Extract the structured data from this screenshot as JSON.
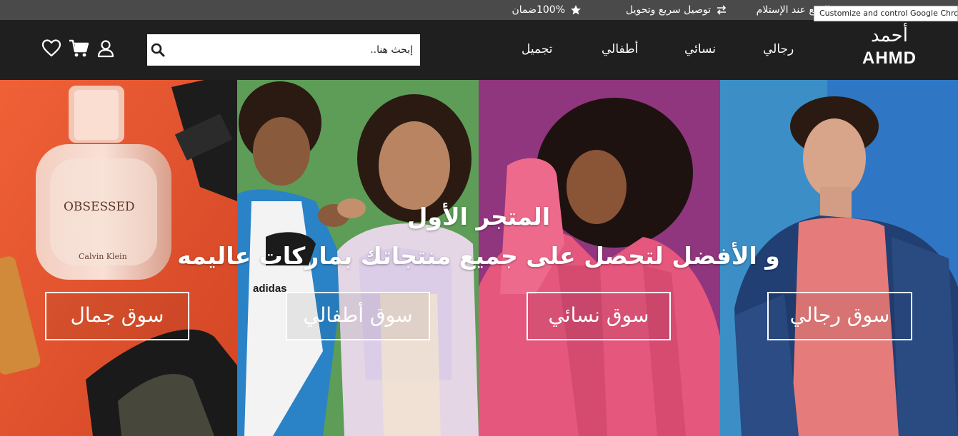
{
  "topbar": {
    "perks": [
      {
        "icon": "box-icon",
        "label": "الدفع عند الإستلام"
      },
      {
        "icon": "exchange-arrows-icon",
        "label": "توصيل سريع وتحويل"
      },
      {
        "icon": "star-icon",
        "label": "100%ضمان"
      }
    ],
    "tooltip": "Customize and control Google Chrome"
  },
  "header": {
    "logo_ar": "أحمد",
    "logo_en": "AHMD",
    "nav": [
      "رجالي",
      "نسائي",
      "أطفالي",
      "تجميل"
    ],
    "search_placeholder": "إبحث هنا..",
    "icons": [
      "user-icon",
      "cart-icon",
      "heart-icon"
    ]
  },
  "hero": {
    "headline_1": "المتجر الأول",
    "headline_2": "و الأفضل لتحصل على جميع منتجاتك بماركات عاليمه",
    "categories": [
      "سوق رجالي",
      "سوق نسائي",
      "سوق أطفالي",
      "سوق جمال"
    ],
    "panel_colors": {
      "beauty": "#e8532e",
      "kids": "#5d9d57",
      "women": "#9b3b7a",
      "men": "#2f77c4"
    },
    "product_text": {
      "perfume_brand": "OBSESSED",
      "perfume_maker": "Calvin Klein",
      "tee_brand": "adidas"
    }
  }
}
